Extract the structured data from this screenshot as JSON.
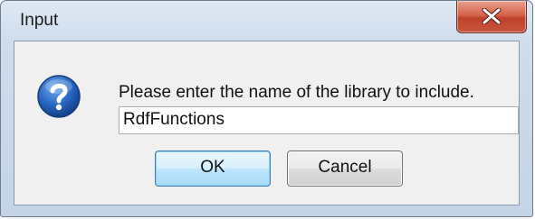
{
  "dialog": {
    "title": "Input",
    "icon": "question-icon",
    "prompt": "Please enter the name of the library to include.",
    "input_value": "RdfFunctions",
    "ok_label": "OK",
    "cancel_label": "Cancel",
    "close_icon": "close-icon"
  },
  "colors": {
    "titlebar": "#cfdcec",
    "client_bg": "#f0f0f0",
    "close_button": "#c9543c",
    "ok_button_border": "#3c7fb1",
    "question_icon": "#1f5fb4"
  }
}
